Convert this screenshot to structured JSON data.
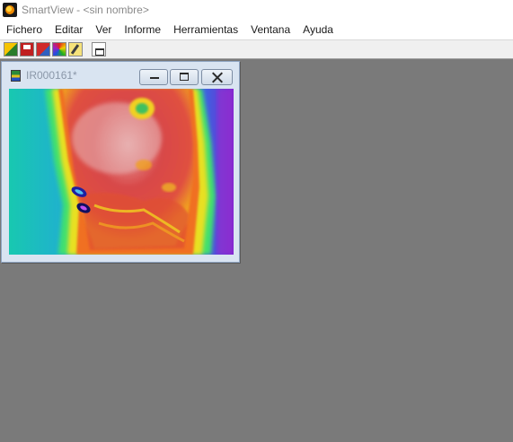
{
  "window": {
    "title": "SmartView - <sin nombre>",
    "icon": "smartview-app-icon"
  },
  "menu": {
    "items": [
      "Fichero",
      "Editar",
      "Ver",
      "Informe",
      "Herramientas",
      "Ventana",
      "Ayuda"
    ]
  },
  "toolbar": {
    "buttons": [
      "open-icon",
      "save-icon",
      "report-icon",
      "palette-icon",
      "edit-icon",
      "print-icon"
    ]
  },
  "child_window": {
    "title": "IR000161*",
    "icon": "ir-image-icon",
    "controls": [
      "minimize-icon",
      "maximize-icon",
      "close-icon"
    ],
    "image": "infrared-thermal-image"
  },
  "colors": {
    "mdi_background": "#7a7a7a",
    "child_frame": "#d9e4f1",
    "thermal_hot": "#d83a3a",
    "thermal_cold": "#1a1aa0"
  }
}
